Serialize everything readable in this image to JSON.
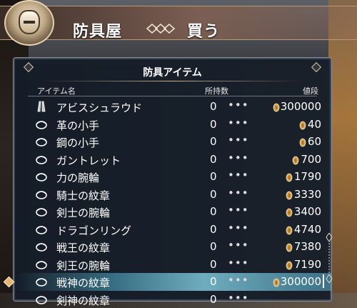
{
  "header": {
    "shop_name": "防具屋",
    "mode_label": "買う"
  },
  "panel": {
    "title": "防具アイテム",
    "columns": {
      "name": "アイテム名",
      "owned": "所持数",
      "price": "値段"
    }
  },
  "items": [
    {
      "name": "アビスシュラウド",
      "owned": "0",
      "price": "300000",
      "icon": "shroud-icon"
    },
    {
      "name": "革の小手",
      "owned": "0",
      "price": "40",
      "icon": "gauntlet-icon"
    },
    {
      "name": "鋼の小手",
      "owned": "0",
      "price": "60",
      "icon": "gauntlet-icon"
    },
    {
      "name": "ガントレット",
      "owned": "0",
      "price": "700",
      "icon": "gauntlet-icon"
    },
    {
      "name": "力の腕輪",
      "owned": "0",
      "price": "1790",
      "icon": "bracelet-icon"
    },
    {
      "name": "騎士の紋章",
      "owned": "0",
      "price": "3330",
      "icon": "crest-icon"
    },
    {
      "name": "剣士の腕輪",
      "owned": "0",
      "price": "3400",
      "icon": "bracelet-icon"
    },
    {
      "name": "ドラゴンリング",
      "owned": "0",
      "price": "4740",
      "icon": "ring-icon"
    },
    {
      "name": "戦王の紋章",
      "owned": "0",
      "price": "7380",
      "icon": "crest-icon"
    },
    {
      "name": "剣王の腕輪",
      "owned": "0",
      "price": "7190",
      "icon": "bracelet-icon"
    },
    {
      "name": "戦神の紋章",
      "owned": "0",
      "price": "300000",
      "icon": "crest-icon",
      "selected": true
    },
    {
      "name": "剣神の紋章",
      "owned": "0",
      "price": "",
      "icon": "crest-icon"
    }
  ],
  "dots_text": "•••",
  "colors": {
    "coin": "#d9a95b",
    "highlight": "#7fd3ea"
  }
}
